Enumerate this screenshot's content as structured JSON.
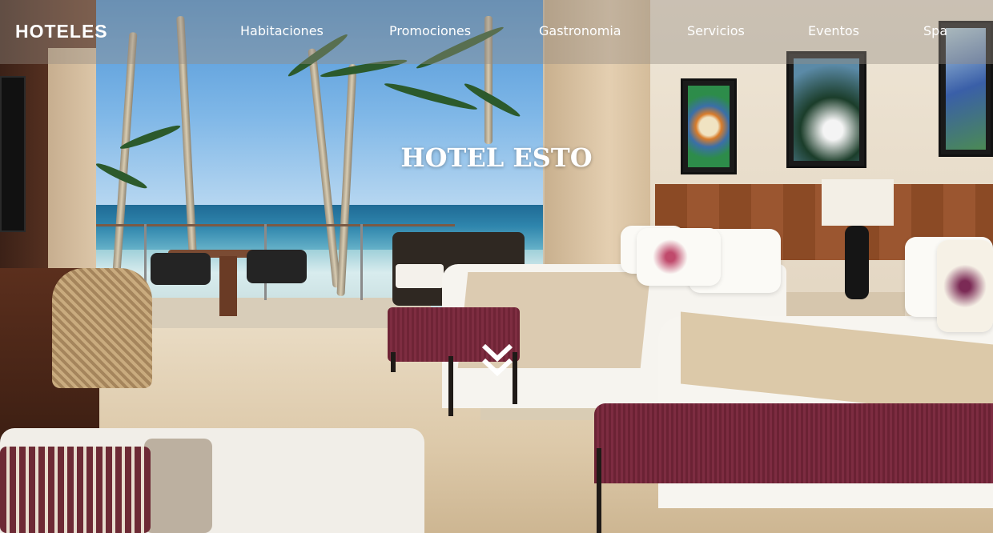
{
  "brand": {
    "logo_text": "HOTELES"
  },
  "nav": {
    "items": [
      {
        "label": "Habitaciones"
      },
      {
        "label": "Promociones"
      },
      {
        "label": "Gastronomia"
      },
      {
        "label": "Servicios"
      },
      {
        "label": "Eventos"
      },
      {
        "label": "Spa"
      }
    ]
  },
  "hero": {
    "title": "HOTEL ESTO",
    "scroll_icon": "double-chevron-down-icon",
    "background_image": "hotel room with two beds and ocean view balcony"
  },
  "colors": {
    "nav_text": "#ffffff",
    "nav_bar": "rgba(150,140,130,0.42)",
    "title": "#ffffff"
  }
}
